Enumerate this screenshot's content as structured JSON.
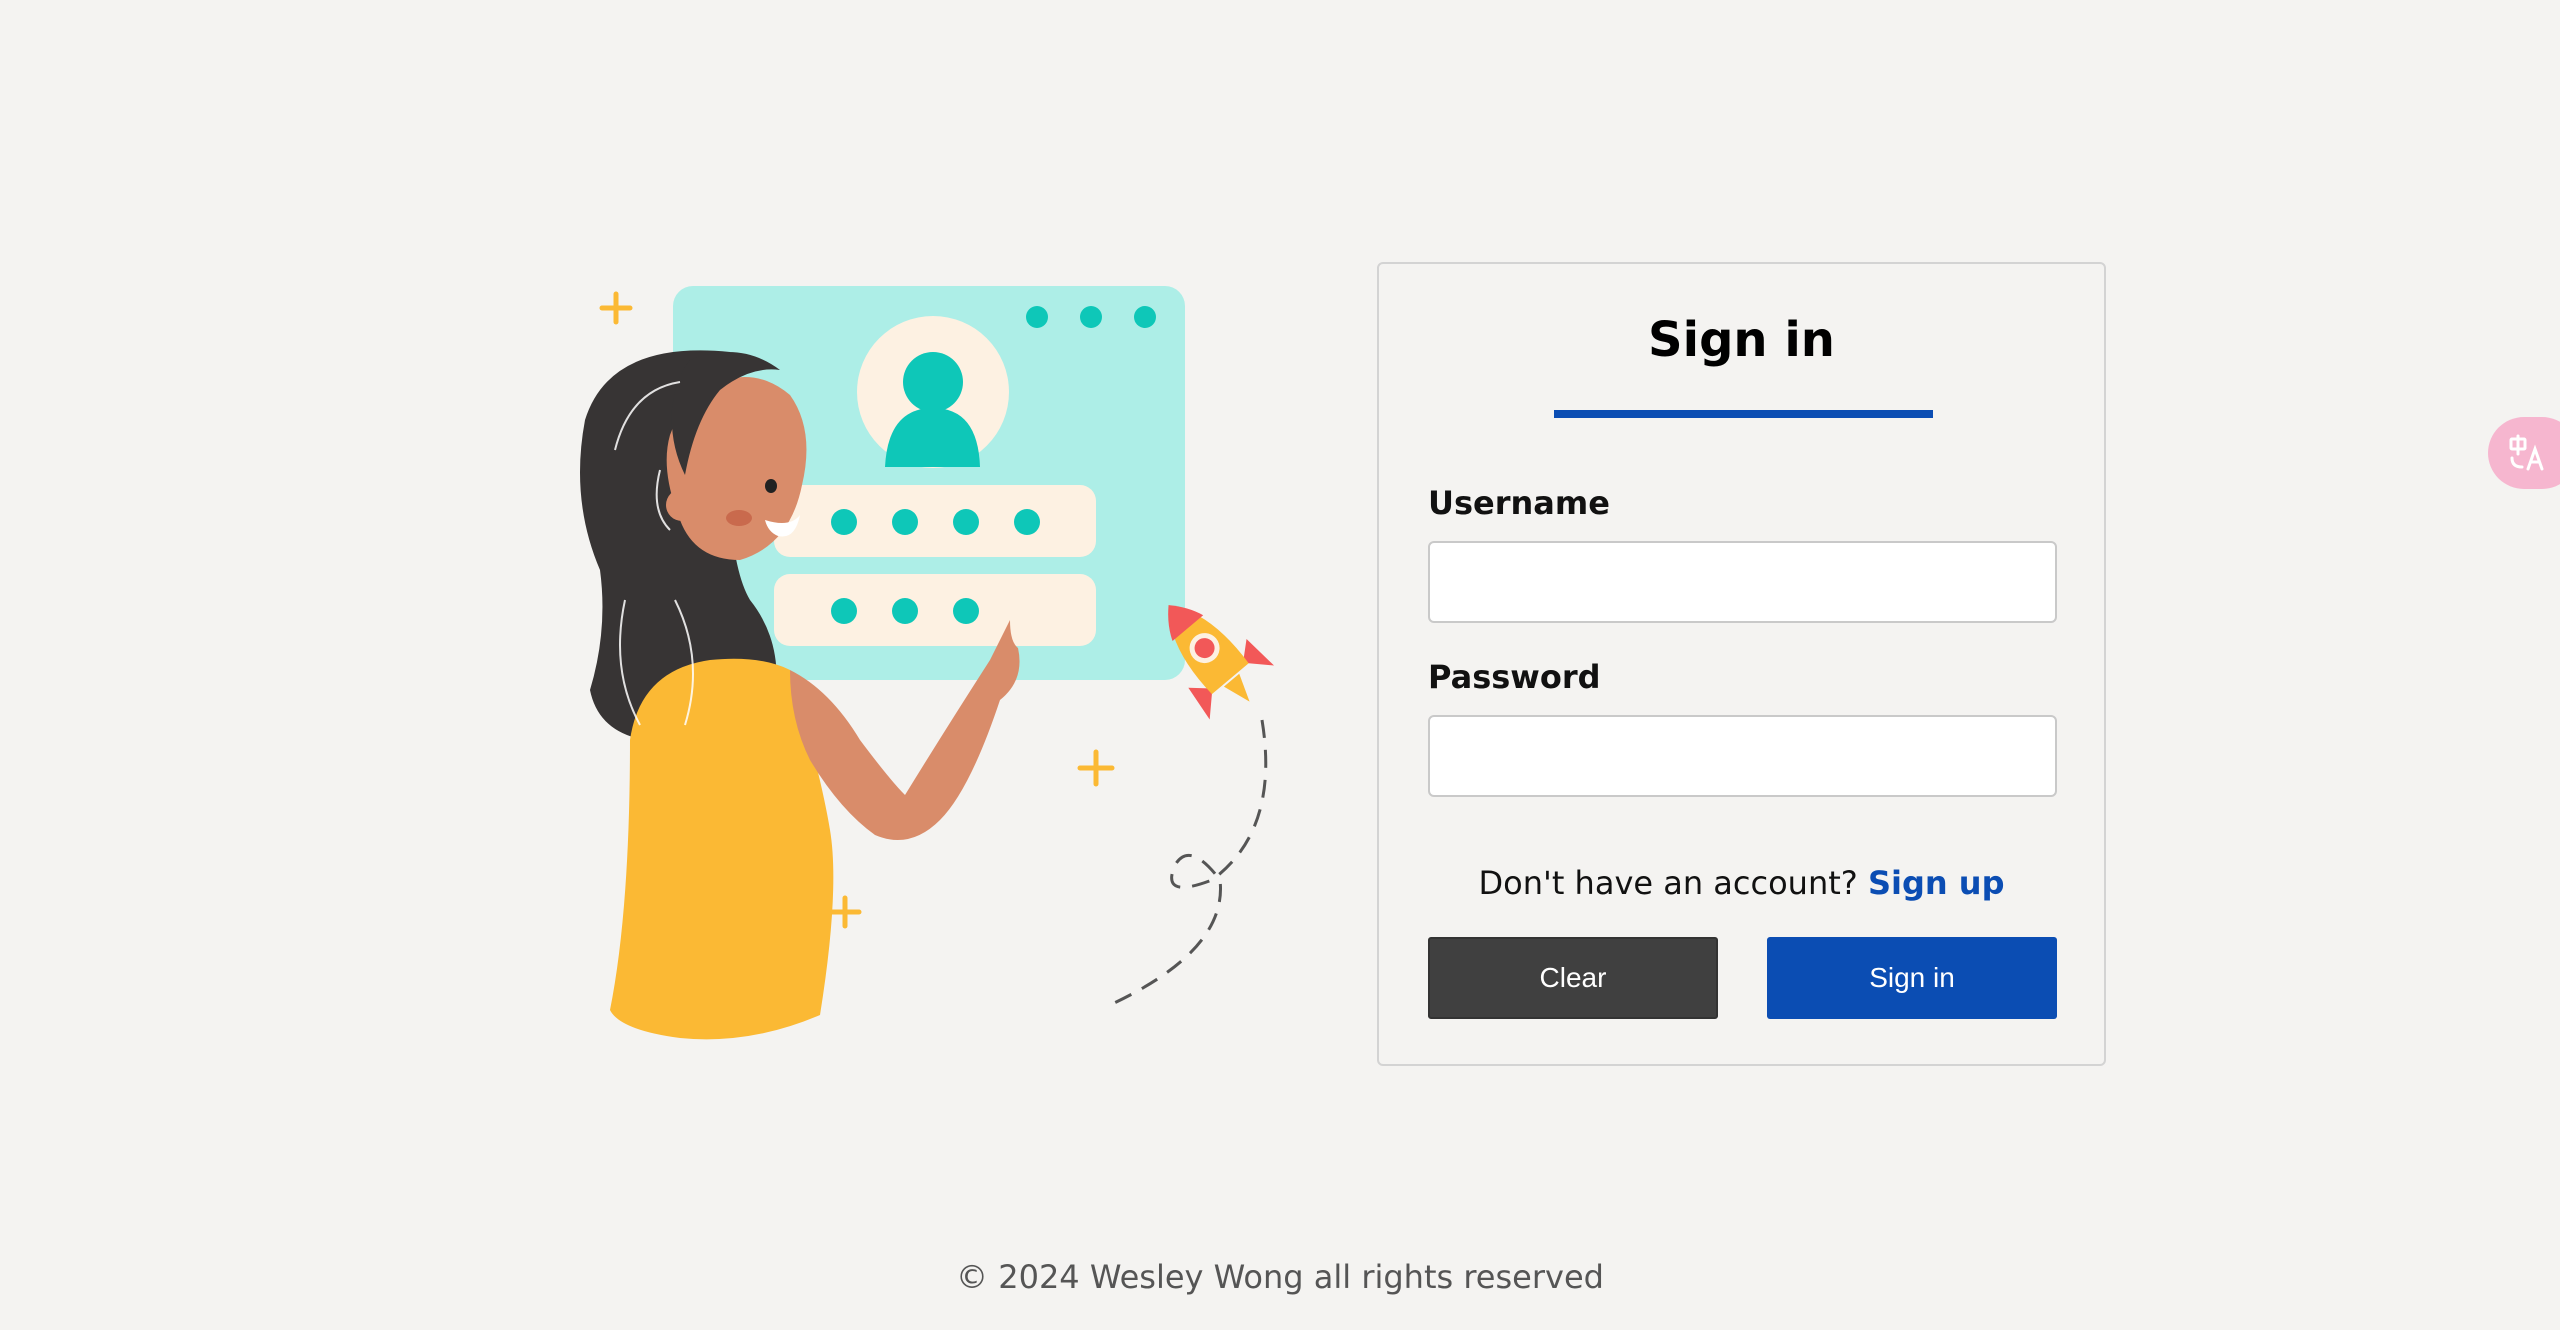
{
  "login": {
    "title": "Sign in",
    "username_label": "Username",
    "username_value": "",
    "password_label": "Password",
    "password_value": "",
    "signup_prompt": "Don't have an account?",
    "signup_link": "Sign up",
    "clear_button": "Clear",
    "signin_button": "Sign in"
  },
  "footer": {
    "copyright": "© 2024 Wesley Wong all rights reserved"
  },
  "colors": {
    "accent": "#0b4db3",
    "clear_button": "#404040",
    "background": "#f4f3f1"
  },
  "icons": {
    "translate": "translate-icon"
  }
}
